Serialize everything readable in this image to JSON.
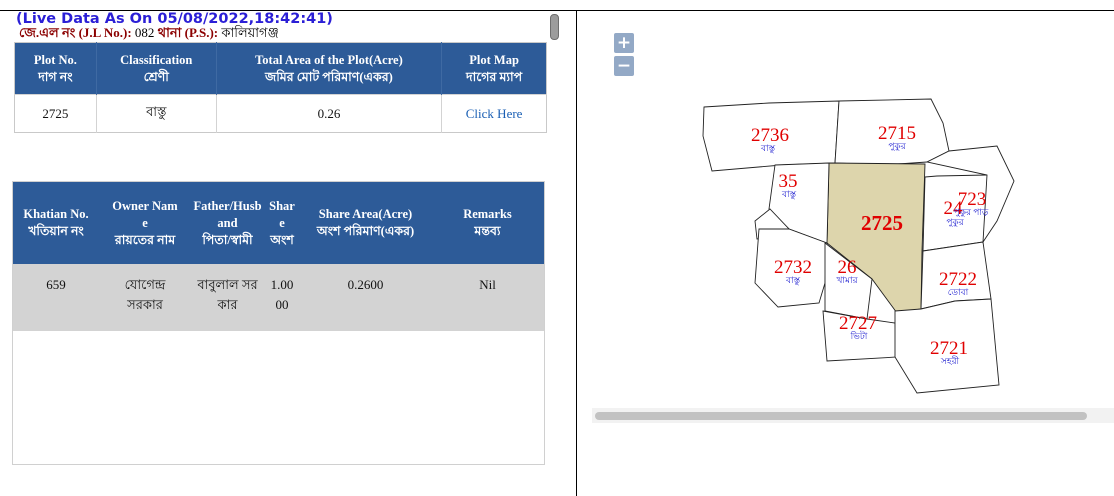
{
  "header": {
    "live_text": "(Live Data As On 05/08/2022,18:42:41)",
    "jl_label": "জে.এল নং (J.L No.):",
    "jl_value": " 082 ",
    "ps_label": "থানা (P.S.):",
    "ps_value": " কালিয়াগঞ্জ"
  },
  "plot_table": {
    "headers": [
      {
        "en": "Plot No.",
        "bn": "দাগ নং"
      },
      {
        "en": "Classification",
        "bn": "শ্রেণী"
      },
      {
        "en": "Total Area of the Plot(Acre)",
        "bn": "জমির মোট পরিমাণ(একর)"
      },
      {
        "en": "Plot Map",
        "bn": "দাগের ম্যাপ"
      }
    ],
    "row": {
      "plot_no": "2725",
      "classification": "বাস্তু",
      "area": "0.26",
      "map_link": "Click Here"
    }
  },
  "owner_table": {
    "headers": [
      {
        "l1": "",
        "l2": "Khatian No.",
        "l3": "খতিয়ান নং"
      },
      {
        "l1": "Owner Nam",
        "l2": "e",
        "l3": "রায়তের নাম"
      },
      {
        "l1": "Father/Husb",
        "l2": "and",
        "l3": "পিতা/স্বামী"
      },
      {
        "l1": "Shar",
        "l2": "e",
        "l3": "অংশ"
      },
      {
        "l1": "",
        "l2": "Share Area(Acre)",
        "l3": "অংশ পরিমাণ(একর)"
      },
      {
        "l1": "",
        "l2": "Remarks",
        "l3": "মন্তব্য"
      }
    ],
    "row": {
      "khatian": "659",
      "owner_1": "যোগেন্দ্র",
      "owner_2": "সরকার",
      "father_1": "বাবুলাল সর",
      "father_2": "কার",
      "share_1": "1.00",
      "share_2": "00",
      "share_area": "0.2600",
      "remarks": "Nil"
    }
  },
  "map": {
    "zoom_in": "+",
    "zoom_out": "−",
    "highlight_color": "#ddd5ac",
    "number_color": "#e00000",
    "class_color": "#1f1fd0",
    "plots": [
      {
        "id": "2736",
        "cls": "বাস্তু"
      },
      {
        "id": "2715",
        "cls": "পুকুর"
      },
      {
        "id": "35",
        "cls": "বাস্তু"
      },
      {
        "id": "2725",
        "cls": ""
      },
      {
        "id": "24",
        "cls": "পুকুর"
      },
      {
        "id": "723",
        "cls": "পুকুর পাড়"
      },
      {
        "id": "2732",
        "cls": "বাস্তু"
      },
      {
        "id": "26",
        "cls": "খামার"
      },
      {
        "id": "2722",
        "cls": "ডোবা"
      },
      {
        "id": "2727",
        "cls": "ভিটা"
      },
      {
        "id": "2721",
        "cls": "সহরী"
      }
    ]
  }
}
